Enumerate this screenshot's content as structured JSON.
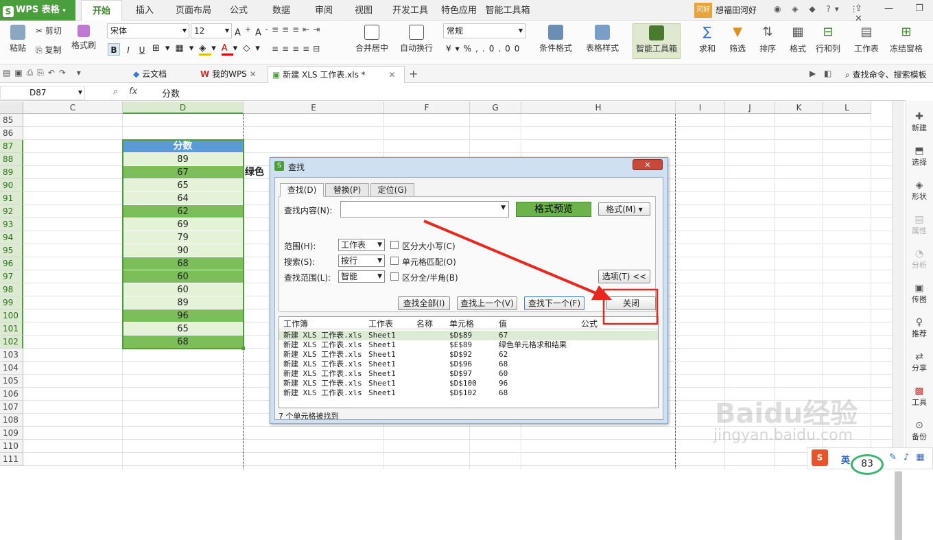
{
  "app": {
    "title": "WPS 表格",
    "user": "想福田河好",
    "user_badge": "河好"
  },
  "menu_tabs": [
    "开始",
    "插入",
    "页面布局",
    "公式",
    "数据",
    "审阅",
    "视图",
    "开发工具",
    "特色应用",
    "智能工具箱"
  ],
  "ribbon": {
    "paste": "粘贴",
    "cut": "剪切",
    "copy": "复制",
    "format_painter": "格式刷",
    "font_name": "宋体",
    "font_size": "12",
    "bold": "B",
    "italic": "I",
    "underline": "U",
    "merge_center": "合并居中",
    "wrap_text": "自动换行",
    "number_format": "常规",
    "cond_format": "条件格式",
    "table_style": "表格样式",
    "smart_toolbox": "智能工具箱",
    "sum": "求和",
    "filter": "筛选",
    "sort": "排序",
    "format": "格式",
    "row_col": "行和列",
    "worksheet": "工作表",
    "freeze": "冻结窗格"
  },
  "doc_tabs": [
    "云文档",
    "我的WPS",
    "新建 XLS 工作表.xls *"
  ],
  "search_cmd": "查找命令、搜索模板",
  "formula_bar": {
    "cell_ref": "D87",
    "fx": "fx",
    "content": "分数"
  },
  "columns": [
    "C",
    "D",
    "E",
    "F",
    "G",
    "H",
    "I",
    "J",
    "K",
    "L"
  ],
  "rows": [
    "85",
    "86",
    "87",
    "88",
    "89",
    "90",
    "91",
    "92",
    "93",
    "94",
    "95",
    "96",
    "97",
    "98",
    "99",
    "100",
    "101",
    "102",
    "103",
    "104",
    "105",
    "106",
    "107",
    "108",
    "109",
    "110",
    "111"
  ],
  "column_D": {
    "header": "分数",
    "values": [
      {
        "v": "89",
        "dark": false
      },
      {
        "v": "67",
        "dark": true
      },
      {
        "v": "65",
        "dark": false
      },
      {
        "v": "64",
        "dark": false
      },
      {
        "v": "62",
        "dark": true
      },
      {
        "v": "69",
        "dark": false
      },
      {
        "v": "79",
        "dark": false
      },
      {
        "v": "90",
        "dark": false
      },
      {
        "v": "68",
        "dark": true
      },
      {
        "v": "60",
        "dark": true
      },
      {
        "v": "60",
        "dark": false
      },
      {
        "v": "89",
        "dark": false
      },
      {
        "v": "96",
        "dark": true
      },
      {
        "v": "65",
        "dark": false
      },
      {
        "v": "68",
        "dark": true
      }
    ]
  },
  "overflow_text": "绿色",
  "colors": {
    "green_dark": "#7cbf5a",
    "green_light": "#e4f2d8",
    "header_blue": "#5b9bd5",
    "accent_green": "#4a9e3c",
    "annotation_red": "#e8271f"
  },
  "dialog": {
    "title": "查找",
    "tabs": [
      "查找(D)",
      "替换(P)",
      "定位(G)"
    ],
    "find_label": "查找内容(N):",
    "find_value": "",
    "format_preview": "格式预览",
    "format_btn": "格式(M)",
    "scope_label": "范围(H):",
    "scope_value": "工作表",
    "search_label": "搜索(S):",
    "search_value": "按行",
    "lookin_label": "查找范围(L):",
    "lookin_value": "智能",
    "match_case": "区分大小写(C)",
    "match_cell": "单元格匹配(O)",
    "match_width": "区分全/半角(B)",
    "options_btn": "选项(T) <<",
    "find_all": "查找全部(I)",
    "find_prev": "查找上一个(V)",
    "find_next": "查找下一个(F)",
    "close": "关闭",
    "result_headers": [
      "工作簿",
      "工作表",
      "名称",
      "单元格",
      "值",
      "公式"
    ],
    "results": [
      {
        "book": "新建 XLS 工作表.xls",
        "sheet": "Sheet1",
        "name": "",
        "cell": "$D$89",
        "value": "67"
      },
      {
        "book": "新建 XLS 工作表.xls",
        "sheet": "Sheet1",
        "name": "",
        "cell": "$E$89",
        "value": "绿色单元格求和结果"
      },
      {
        "book": "新建 XLS 工作表.xls",
        "sheet": "Sheet1",
        "name": "",
        "cell": "$D$92",
        "value": "62"
      },
      {
        "book": "新建 XLS 工作表.xls",
        "sheet": "Sheet1",
        "name": "",
        "cell": "$D$96",
        "value": "68"
      },
      {
        "book": "新建 XLS 工作表.xls",
        "sheet": "Sheet1",
        "name": "",
        "cell": "$D$97",
        "value": "60"
      },
      {
        "book": "新建 XLS 工作表.xls",
        "sheet": "Sheet1",
        "name": "",
        "cell": "$D$100",
        "value": "96"
      },
      {
        "book": "新建 XLS 工作表.xls",
        "sheet": "Sheet1",
        "name": "",
        "cell": "$D$102",
        "value": "68"
      }
    ],
    "status": "7 个单元格被找到"
  },
  "sidebar": [
    "新建",
    "选择",
    "形状",
    "属性",
    "分析",
    "传图",
    "推荐",
    "分享",
    "工具",
    "备份"
  ],
  "ime": {
    "lang": "英",
    "zoom": "83"
  },
  "watermark": {
    "brand": "Baidu经验",
    "url": "jingyan.baidu.com"
  }
}
